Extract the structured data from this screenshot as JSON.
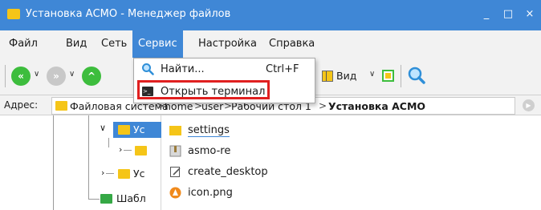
{
  "window": {
    "title": "Установка АСМО - Менеджер файлов",
    "min_icon": "minimize-icon",
    "max_icon": "maximize-icon",
    "close_icon": "close-icon",
    "title_bar_color": "#3f87d6"
  },
  "menubar": {
    "items": [
      "Файл",
      "Вид",
      "Сеть",
      "Сервис",
      "Настройка",
      "Справка"
    ],
    "active": "Сервис"
  },
  "service_menu": {
    "items": [
      {
        "label": "Найти...",
        "shortcut": "Ctrl+F",
        "icon": "search-icon"
      },
      {
        "label": "Открыть терминал",
        "shortcut": "",
        "icon": "terminal-icon",
        "highlighted": true
      }
    ]
  },
  "toolbar": {
    "view_label": "Вид"
  },
  "address": {
    "label": "Адрес:",
    "crumbs": [
      "Файловая система",
      "home",
      "user",
      "Рабочий стол 1",
      "Установка АСМО"
    ],
    "separator": ">"
  },
  "tree": {
    "items": [
      {
        "label": "Ус",
        "expanded": true,
        "selected": true
      },
      {
        "label": "",
        "expanded": false,
        "selected": false
      },
      {
        "label": "Ус",
        "expanded": false,
        "selected": false
      },
      {
        "label": "Шабл",
        "expanded": false,
        "selected": false
      }
    ]
  },
  "files": [
    {
      "name": "settings",
      "icon": "folder-icon"
    },
    {
      "name": "asmo-re",
      "icon": "archive-icon"
    },
    {
      "name": "create_desktop",
      "icon": "script-icon"
    },
    {
      "name": "icon.png",
      "icon": "image-icon"
    }
  ],
  "colors": {
    "accent": "#3f87d6",
    "highlight_box": "#e02020",
    "folder": "#f5c518",
    "nav_green": "#3dbd3d"
  }
}
